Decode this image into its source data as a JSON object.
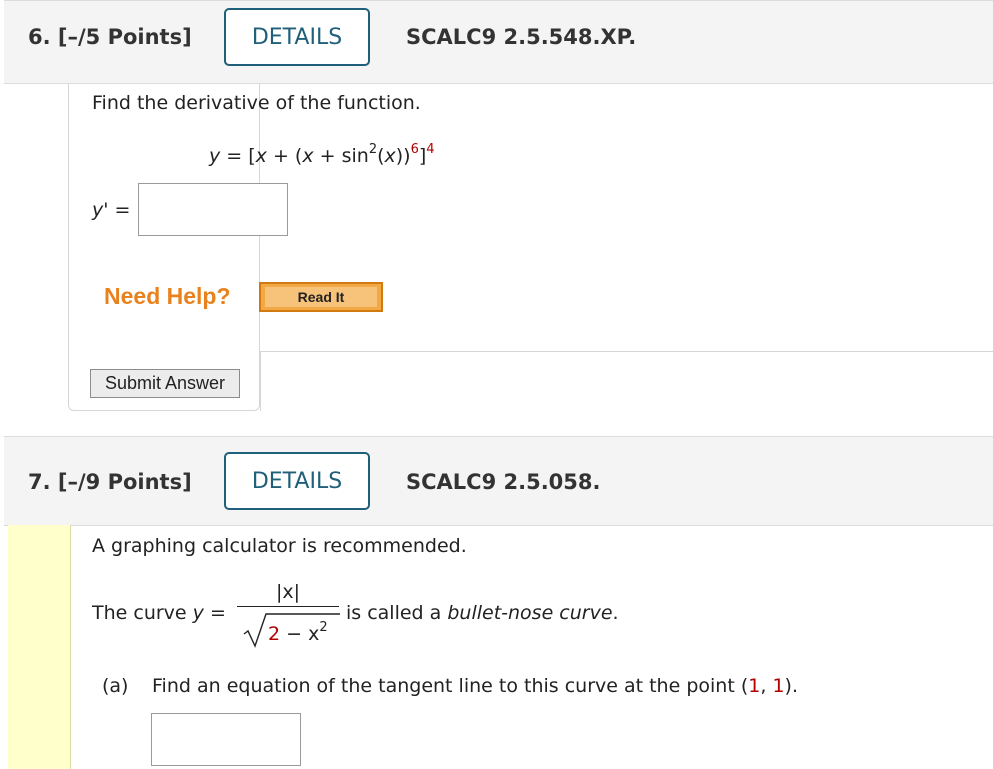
{
  "q6": {
    "number": "6.  [–/5 Points]",
    "details": "DETAILS",
    "id": "SCALC9 2.5.548.XP.",
    "prompt": "Find the derivative of the function.",
    "eq": {
      "lhs": "y",
      "eq": " = [",
      "x1": "x",
      "plus1": " + (",
      "x2": "x",
      "plus2": " + sin",
      "exp2": "2",
      "arg_open": "(",
      "x3": "x",
      "arg_close": "))",
      "exp6": "6",
      "bracket": "]",
      "exp4": "4"
    },
    "yprime_label": "y'",
    "yprime_eq": " =",
    "need_help": "Need Help?",
    "read_it": "Read It",
    "submit": "Submit Answer"
  },
  "q7": {
    "number": "7.  [–/9 Points]",
    "details": "DETAILS",
    "id": "SCALC9 2.5.058.",
    "prompt": "A graphing calculator is recommended.",
    "curve_pre": "The curve ",
    "curve_y": "y",
    "curve_eq": " =",
    "numerator": "|x|",
    "denom_2": "2",
    "denom_minus": " − x",
    "denom_exp": "2",
    "curve_post": " is called a ",
    "curve_name": "bullet-nose curve",
    "curve_end": ".",
    "part_a_label": "(a)",
    "part_a_text": "Find an equation of the tangent line to this curve at the point (",
    "pt_x": "1",
    "pt_sep": ", ",
    "pt_y": "1",
    "pt_end": ")."
  }
}
